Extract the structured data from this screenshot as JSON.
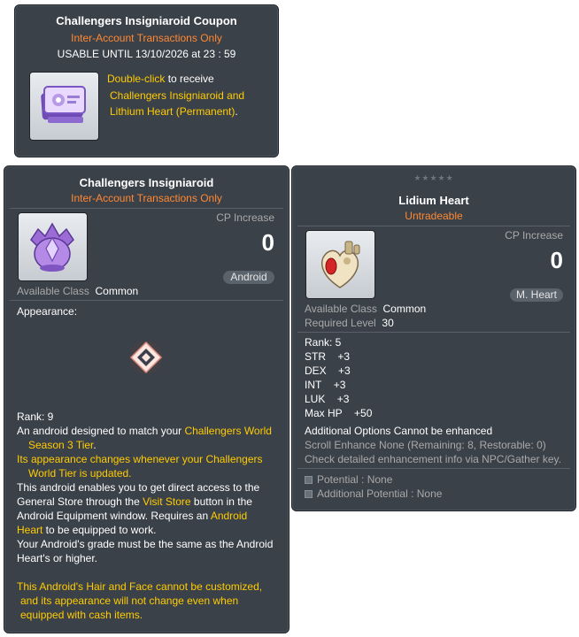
{
  "coupon": {
    "title": "Challengers Insigniaroid Coupon",
    "trade": "Inter-Account Transactions Only",
    "usable": "USABLE UNTIL 13/10/2026 at 23 : 59",
    "desc_link": "Double-click",
    "desc_1": " to receive",
    "desc_2": "Challengers Insigniaroid and",
    "desc_3": "Lithium Heart (Permanent)",
    "desc_3_end": "."
  },
  "android": {
    "title": "Challengers Insigniaroid",
    "trade": "Inter-Account Transactions Only",
    "cp_label": "CP Increase",
    "cp_value": "0",
    "type_badge": "Android",
    "class_label": "Available Class",
    "class_value": "Common",
    "appearance_label": "Appearance:",
    "rank": "Rank: 9",
    "d1a": "An android designed to match your ",
    "d1b": "Challengers World",
    "d2": "Season 3 Tier",
    "d2_end": ".",
    "d3": "Its appearance changes whenever your Challengers",
    "d4": "World Tier is updated.",
    "d5": "This android enables you to get direct access to the",
    "d6a": "General Store through the ",
    "d6b": "Visit Store",
    "d6c": " button in the",
    "d7a": "Android Equipment window. Requires an ",
    "d7b": "Android",
    "d8a": "Heart",
    "d8b": " to be equipped to work.",
    "d9": "Your Android's grade must be the same as the Android",
    "d10": "Heart's or higher.",
    "d11": "This Android's Hair and Face cannot be customized,",
    "d12": "and its appearance will not change even when",
    "d13": "equipped with cash items."
  },
  "heart": {
    "stars": "★★★★★",
    "title": "Lidium Heart",
    "trade": "Untradeable",
    "cp_label": "CP Increase",
    "cp_value": "0",
    "type_badge": "M. Heart",
    "class_label": "Available Class",
    "class_value": "Common",
    "level_label": "Required Level",
    "level_value": "30",
    "rank": "Rank: 5",
    "stats": [
      {
        "name": "STR",
        "value": "+3"
      },
      {
        "name": "DEX",
        "value": "+3"
      },
      {
        "name": "INT",
        "value": "+3"
      },
      {
        "name": "LUK",
        "value": "+3"
      },
      {
        "name": "Max HP",
        "value": "+50"
      }
    ],
    "additional": "Additional Options Cannot be enhanced",
    "scroll": "Scroll Enhance None (Remaining: 8, Restorable: 0)",
    "check": "Check detailed enhancement info via NPC/Gather key.",
    "potential": "Potential : None",
    "add_potential": "Additional Potential : None"
  },
  "colors": {
    "panel": "#3b4149",
    "orange": "#ff8833",
    "yellow": "#ffcc00",
    "grey": "#a9a9a9"
  }
}
